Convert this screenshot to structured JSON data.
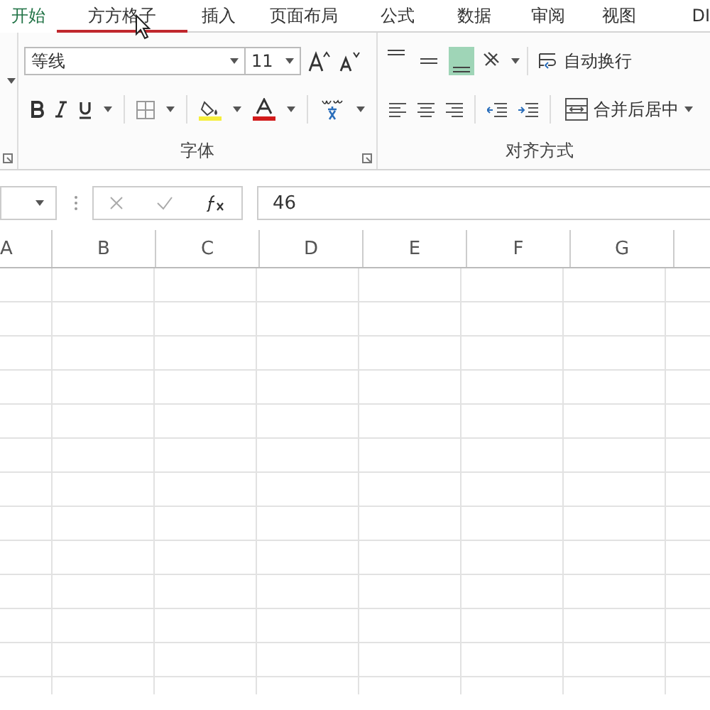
{
  "tabs": [
    {
      "label": "开始",
      "selected": true,
      "hovered": false
    },
    {
      "label": "方方格子",
      "selected": false,
      "hovered": true
    },
    {
      "label": "插入",
      "selected": false,
      "hovered": false
    },
    {
      "label": "页面布局",
      "selected": false,
      "hovered": false
    },
    {
      "label": "公式",
      "selected": false,
      "hovered": false
    },
    {
      "label": "数据",
      "selected": false,
      "hovered": false
    },
    {
      "label": "审阅",
      "selected": false,
      "hovered": false
    },
    {
      "label": "视图",
      "selected": false,
      "hovered": false
    },
    {
      "label": "DI",
      "selected": false,
      "hovered": false
    }
  ],
  "font_group": {
    "font_name": "等线",
    "font_size": "11",
    "label": "字体"
  },
  "alignment_group": {
    "vertical_align": [
      {
        "kind": "top",
        "selected": false
      },
      {
        "kind": "middle",
        "selected": false
      },
      {
        "kind": "bottom",
        "selected": true
      }
    ],
    "wrap_text": "自动换行",
    "merge_center": "合并后居中",
    "label": "对齐方式"
  },
  "formula_bar": {
    "value": "46"
  },
  "columns": [
    "A",
    "B",
    "C",
    "D",
    "E",
    "F",
    "G"
  ]
}
